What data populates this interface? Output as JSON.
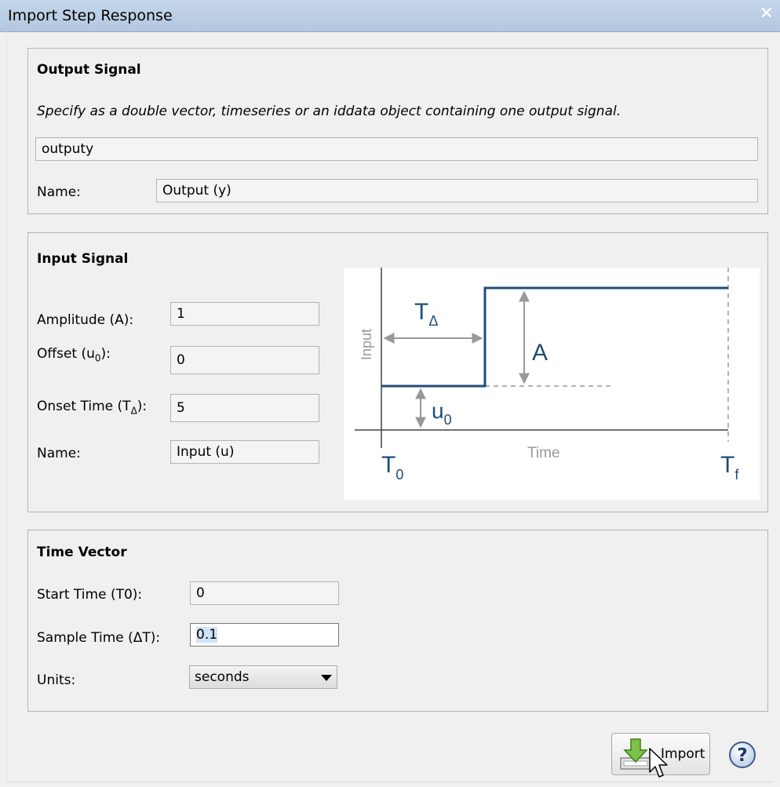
{
  "window": {
    "title": "Import Step Response",
    "close_glyph": "✕"
  },
  "output_signal": {
    "heading": "Output Signal",
    "description": "Specify as a double vector, timeseries or an iddata object containing one output signal.",
    "value": "outputy",
    "name_label": "Name:",
    "name_value": "Output (y)"
  },
  "input_signal": {
    "heading": "Input Signal",
    "amplitude_label": "Amplitude (A):",
    "amplitude_value": "1",
    "offset_label_prefix": "Offset (u",
    "offset_label_sub": "0",
    "offset_label_suffix": "):",
    "offset_value": "0",
    "onset_label_prefix": "Onset Time (T",
    "onset_label_sub": "Δ",
    "onset_label_suffix": "):",
    "onset_value": "5",
    "name_label": "Name:",
    "name_value": "Input (u)",
    "diagram": {
      "y_axis_label": "Input",
      "x_axis_label": "Time",
      "t_delta_main": "T",
      "t_delta_sub": "Δ",
      "amplitude_symbol": "A",
      "u0_main": "u",
      "u0_sub": "0",
      "t0_main": "T",
      "t0_sub": "0",
      "tf_main": "T",
      "tf_sub": "f",
      "line_color": "#1f4e79",
      "annotation_color": "#999999"
    }
  },
  "time_vector": {
    "heading": "Time Vector",
    "start_label": "Start Time (T0):",
    "start_value": "0",
    "sample_label": "Sample Time (ΔT):",
    "sample_value": "0.1",
    "units_label": "Units:",
    "units_value": "seconds"
  },
  "buttons": {
    "import_label": "Import",
    "help_glyph": "?"
  },
  "icons": {
    "import": "import-down-arrow-icon",
    "help": "help-icon",
    "cursor": "mouse-pointer-icon"
  }
}
